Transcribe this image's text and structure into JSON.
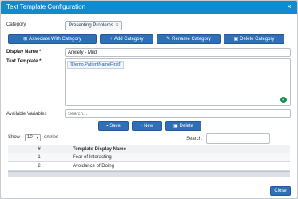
{
  "dialog": {
    "title": "Text Template Configuration",
    "close_glyph": "×"
  },
  "category": {
    "label": "Category",
    "chip_text": "Presenting Problems",
    "chip_remove": "×"
  },
  "category_buttons": [
    {
      "label": "Associate With Category",
      "icon": "sitemap-icon",
      "glyph": "⊞"
    },
    {
      "label": "Add Category",
      "icon": "plus-icon",
      "glyph": "+"
    },
    {
      "label": "Rename Category",
      "icon": "pencil-icon",
      "glyph": "✎"
    },
    {
      "label": "Delete Category",
      "icon": "trash-icon",
      "glyph": "▣"
    }
  ],
  "display_name": {
    "label": "Display Name *",
    "value": "Anxiety - Mild"
  },
  "text_template": {
    "label": "Text Template *",
    "token": "[[Demo.PatientNameFirst]]"
  },
  "available_variables": {
    "label": "Available Variables",
    "placeholder": "Search..."
  },
  "action_buttons": {
    "save": "Save",
    "new": "New",
    "delete": "Delete"
  },
  "table_controls": {
    "show_label": "Show",
    "page_size": "10",
    "entries_label": "entries",
    "search_label": "Search:"
  },
  "table": {
    "columns": [
      "#",
      "Template Display Name"
    ],
    "rows": [
      {
        "num": "1",
        "name": "Fear of Interacting"
      },
      {
        "num": "2",
        "name": "Avoidance of Doing"
      }
    ]
  },
  "footer": {
    "close_label": "Close"
  },
  "colors": {
    "accent": "#0f8ccf",
    "button": "#2f6fb7"
  }
}
